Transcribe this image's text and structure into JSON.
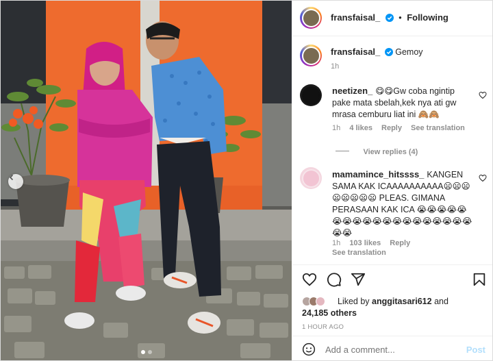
{
  "post": {
    "author": "fransfaisal_",
    "follow_status": "Following",
    "caption": {
      "author": "fransfaisal_",
      "text": "Gemoy",
      "age": "1h"
    }
  },
  "comments": [
    {
      "author": "neetizen_",
      "text": "😋😋Gw coba ngintip pake mata sbelah,kek nya ati gw mrasa cemburu liat ini 🙈🙈",
      "age": "1h",
      "likes": "4 likes",
      "reply": "Reply",
      "translate": "See translation",
      "view_replies": "View replies (4)"
    },
    {
      "author": "mamamince_hitssss_",
      "text": "KANGEN SAMA KAK ICAAAAAAAAAA😦😦😦😦😦😦😦😦 PLEAS. GIMANA PERASAAN KAK ICA 😭😭😭😭😭😭😭😭😭😭😭😭😭😭😭😭😭😭😭😭😭",
      "age": "1h",
      "likes": "103 likes",
      "reply": "Reply",
      "translate": "See translation"
    }
  ],
  "likes": {
    "prefix": "Liked by",
    "user": "anggitasari612",
    "and": "and",
    "others": "24,185 others"
  },
  "timestamp": "1 HOUR AGO",
  "add_comment": {
    "placeholder": "Add a comment...",
    "post_label": "Post"
  },
  "carousel": {
    "slides": 2,
    "active_index": 1
  },
  "colors": {
    "accent_blue": "#0095f6",
    "post_disabled": "#b2dffc",
    "text_primary": "#262626",
    "text_secondary": "#8e8e8e",
    "verified": "#0095f6"
  },
  "icons": {
    "verified": "verified-badge-icon",
    "heart": "heart-icon",
    "comment": "comment-icon",
    "share": "share-icon",
    "save": "bookmark-icon",
    "emoji": "emoji-icon",
    "prev": "chevron-left-icon"
  }
}
